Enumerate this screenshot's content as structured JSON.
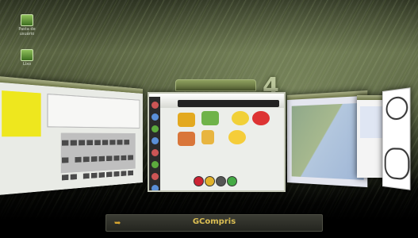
{
  "desktop": {
    "icons": [
      {
        "name": "home-folder-icon",
        "label": "Pasta de usuário"
      },
      {
        "name": "trash-icon",
        "label": "Lixo"
      }
    ]
  },
  "switcher": {
    "workspace_number": "4",
    "active_window_title": "GCompris",
    "active_window_icon": "gcompris-app-icon"
  }
}
